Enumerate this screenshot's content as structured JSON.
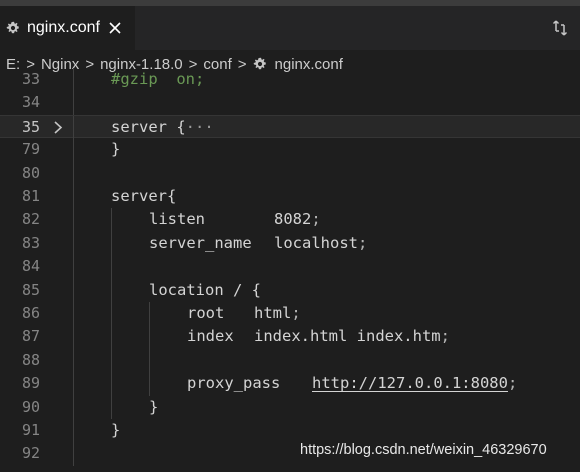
{
  "tab": {
    "label": "nginx.conf",
    "icon": "gear-icon",
    "close_icon": "close-icon"
  },
  "tabbar_action_icon": "compare-changes-icon",
  "breadcrumb": {
    "items": [
      "E:",
      "Nginx",
      "nginx-1.18.0",
      "conf",
      "nginx.conf"
    ],
    "separator": ">"
  },
  "editor": {
    "lines": [
      {
        "num": "33",
        "text": "#gzip  on;"
      },
      {
        "num": "34",
        "text": ""
      },
      {
        "num": "35",
        "text": "server {",
        "folded": "···"
      },
      {
        "num": "79",
        "text": "}"
      },
      {
        "num": "80",
        "text": ""
      },
      {
        "num": "81",
        "text": "server{"
      },
      {
        "num": "82",
        "key": "listen",
        "value": "8082",
        "semi": ";"
      },
      {
        "num": "83",
        "key": "server_name",
        "value": "localhost",
        "semi": ";"
      },
      {
        "num": "84",
        "text": ""
      },
      {
        "num": "85",
        "text": "location / {"
      },
      {
        "num": "86",
        "key": "root",
        "value": "html",
        "semi": ";"
      },
      {
        "num": "87",
        "key": "index",
        "value": "index.html index.htm",
        "semi": ";"
      },
      {
        "num": "88",
        "text": ""
      },
      {
        "num": "89",
        "key": "proxy_pass",
        "value": "http://127.0.0.1:8080",
        "semi": ";"
      },
      {
        "num": "90",
        "text": "}"
      },
      {
        "num": "91",
        "text": "}"
      },
      {
        "num": "92",
        "text": ""
      }
    ]
  },
  "watermark": "https://blog.csdn.net/weixin_46329670",
  "colors": {
    "background": "#1e1e1e",
    "comment": "#6a9955",
    "line_number": "#858585"
  }
}
